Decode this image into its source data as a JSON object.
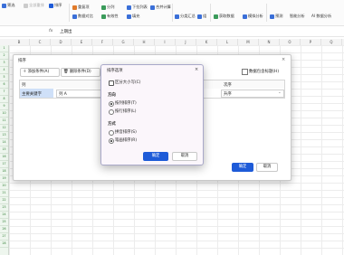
{
  "ribbon": {
    "filter": "筛选",
    "reapply": "全部重排",
    "sort": "排序",
    "dup": "重复项",
    "compare": "数据对比",
    "split": "分列",
    "fill": "填充",
    "validity": "有效性",
    "dropdown": "下拉列表",
    "consolidate": "合并计算",
    "subtotal": "分类汇总",
    "group": "组",
    "ungroup": "取消组合",
    "getdata": "获取数据",
    "pivot": "模拟分析",
    "forecast": "预测",
    "smartanalysis": "智能分析",
    "ai": "AI 数据分析"
  },
  "formula_bar": {
    "fx": "fx",
    "value": "上期出"
  },
  "columns": [
    "B",
    "C",
    "D",
    "E",
    "F",
    "G",
    "H",
    "I",
    "J",
    "K",
    "L",
    "M",
    "N",
    "O",
    "P",
    "Q"
  ],
  "rows": [
    "1",
    "2",
    "3",
    "4",
    "5",
    "6",
    "7",
    "8",
    "9",
    "10",
    "11",
    "12",
    "13",
    "14",
    "15",
    "16",
    "17",
    "18",
    "19",
    "20",
    "21",
    "22",
    "23",
    "24",
    "25",
    "26",
    "27",
    "28"
  ],
  "sort_dialog": {
    "title": "排序",
    "add_condition": "添加条件(A)",
    "delete_condition": "删除条件(D)",
    "copy_condition": "复制条件(C)",
    "options": "选项(O)...",
    "header_checkbox": "数据包含标题(H)",
    "col_header": "列",
    "order_header": "次序",
    "row_label": "主要关键字",
    "key_value": "列 A",
    "order_value": "升序",
    "ok": "确定",
    "cancel": "取消"
  },
  "options_dialog": {
    "title": "排序选项",
    "case_sensitive": "区分大小写(C)",
    "direction_label": "方向",
    "dir_col": "按列排序(T)",
    "dir_row": "按行排序(L)",
    "method_label": "方式",
    "method_pinyin": "拼音排序(S)",
    "method_stroke": "笔画排序(R)",
    "ok": "确定",
    "cancel": "取消",
    "accent": "#1e5bd8"
  }
}
